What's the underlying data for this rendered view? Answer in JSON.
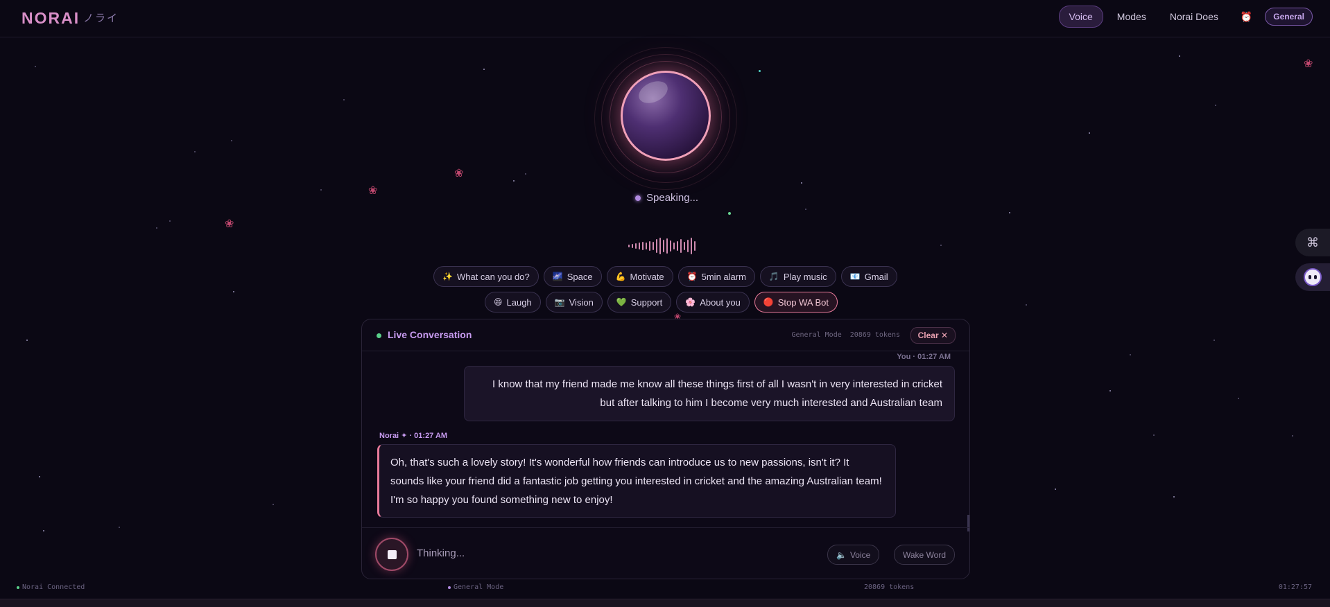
{
  "brand": {
    "name": "NORAI",
    "subtitle": "ノライ"
  },
  "nav": {
    "items": [
      {
        "label": "Voice",
        "active": true
      },
      {
        "label": "Modes",
        "active": false
      },
      {
        "label": "Norai Does",
        "active": false
      }
    ],
    "alarm_icon": "alarm-clock-icon",
    "mode_badge": "General"
  },
  "orb": {
    "status": "Speaking..."
  },
  "quick_actions": {
    "row1": [
      {
        "icon": "✨",
        "label": "What can you do?"
      },
      {
        "icon": "🌌",
        "label": "Space"
      },
      {
        "icon": "💪",
        "label": "Motivate"
      },
      {
        "icon": "⏰",
        "label": "5min alarm"
      },
      {
        "icon": "🎵",
        "label": "Play music"
      },
      {
        "icon": "📧",
        "label": "Gmail"
      }
    ],
    "row2": [
      {
        "icon": "😄",
        "label": "Laugh"
      },
      {
        "icon": "📷",
        "label": "Vision"
      },
      {
        "icon": "💚",
        "label": "Support"
      },
      {
        "icon": "🌸",
        "label": "About you"
      },
      {
        "icon": "🔴",
        "label": "Stop WA Bot"
      }
    ]
  },
  "conversation": {
    "title": "Live Conversation",
    "mode": "General Mode",
    "tokens": "20869 tokens",
    "clear_label": "Clear ✕",
    "messages": [
      {
        "sender": "You · 01:27 AM",
        "text": "I know that my friend made me know all these things first of all I wasn't in very interested in cricket but after talking to him I become very much interested and Australian team"
      },
      {
        "sender": "Norai ✦ · 01:27 AM",
        "text": "Oh, that's such a lovely story! It's wonderful how friends can introduce us to new passions, isn't it? It sounds like your friend did a fantastic job getting you interested in cricket and the amazing Australian team! I'm so happy you found something new to enjoy!"
      }
    ],
    "footer": {
      "status": "Thinking...",
      "voice_label": "Voice",
      "wake_label": "Wake Word"
    }
  },
  "statusbar": {
    "connection": "Norai Connected",
    "mode": "General Mode",
    "tokens": "20869 tokens",
    "time": "01:27:57"
  },
  "colors": {
    "accent": "#c79bf0",
    "pink": "#e87a9a",
    "live_green": "#5ad08a",
    "background": "#0b0814"
  }
}
